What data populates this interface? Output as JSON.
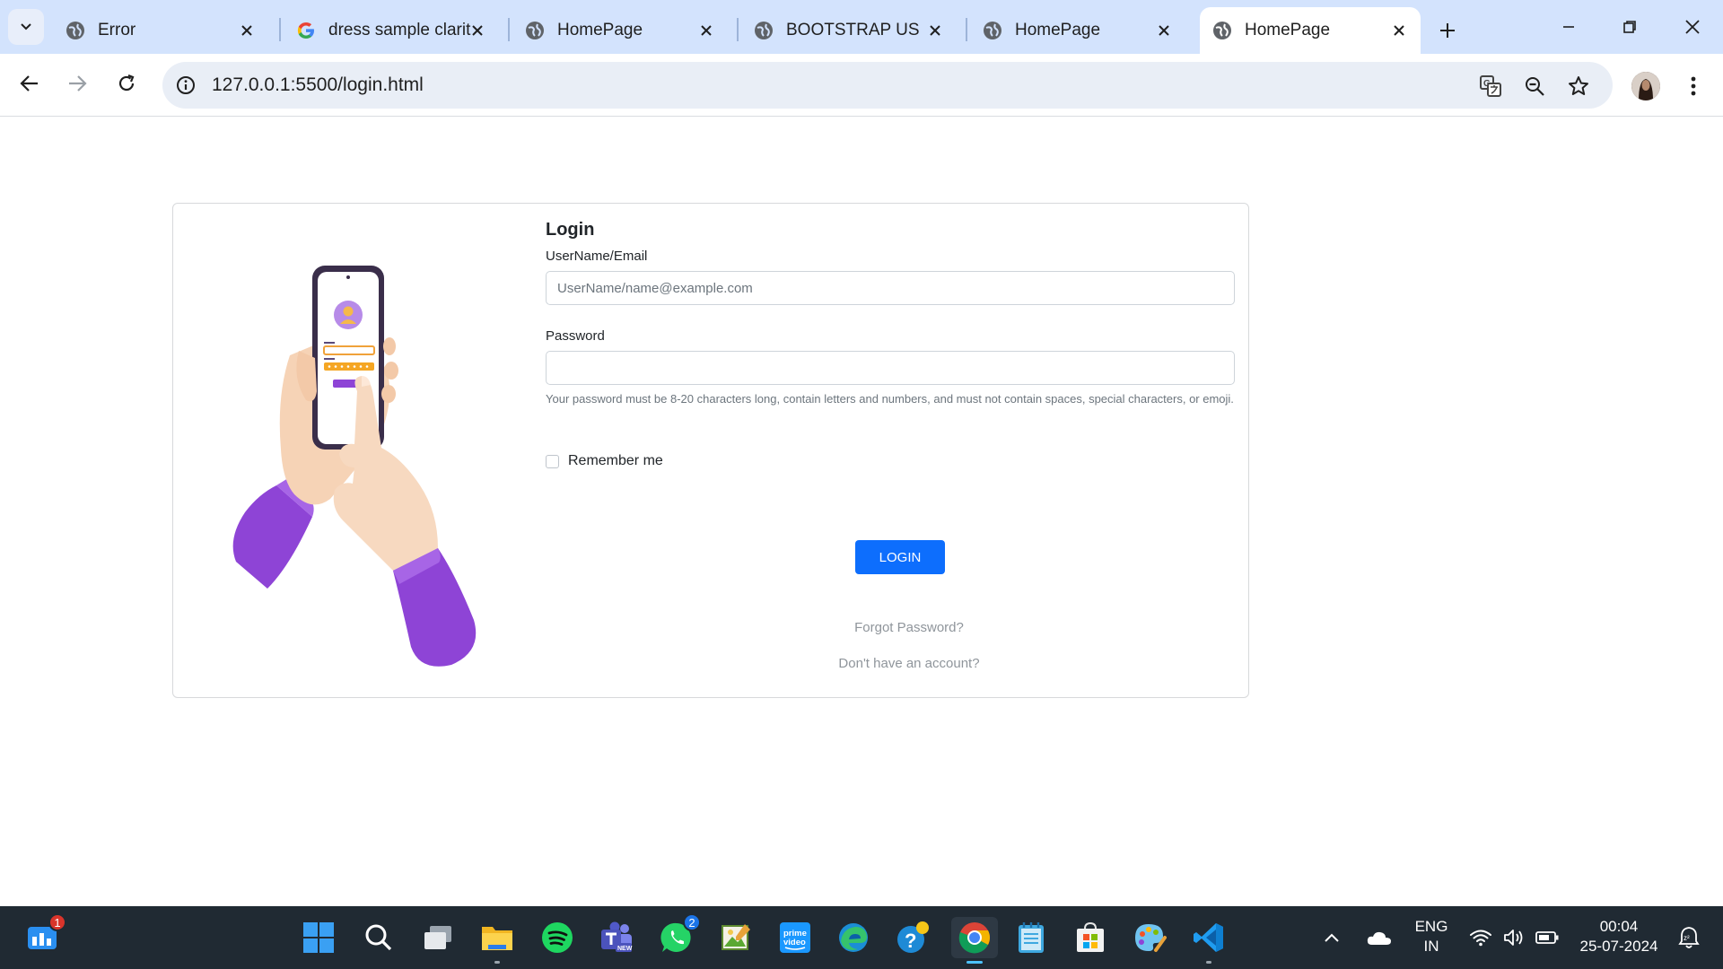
{
  "browser": {
    "tabs": [
      {
        "title": "Error",
        "icon": "globe-icon",
        "active": false
      },
      {
        "title": "dress sample clarit",
        "icon": "google-icon",
        "active": false
      },
      {
        "title": "HomePage",
        "icon": "globe-icon",
        "active": false
      },
      {
        "title": "BOOTSTRAP USING",
        "icon": "globe-icon",
        "active": false
      },
      {
        "title": "HomePage",
        "icon": "globe-icon",
        "active": false
      },
      {
        "title": "HomePage",
        "icon": "globe-icon",
        "active": true
      }
    ],
    "url": "127.0.0.1:5500/login.html"
  },
  "login": {
    "heading": "Login",
    "username_label": "UserName/Email",
    "username_placeholder": "UserName/name@example.com",
    "password_label": "Password",
    "password_help": "Your password must be 8-20 characters long, contain letters and numbers, and must not contain spaces, special characters, or emoji.",
    "remember_label": "Remember me",
    "login_button": "LOGIN",
    "forgot_link": "Forgot Password?",
    "signup_link": "Don't have an account?"
  },
  "taskbar": {
    "widgets_badge": "1",
    "whatsapp_badge": "2",
    "language": "ENG",
    "region": "IN",
    "time": "00:04",
    "date": "25-07-2024"
  },
  "colors": {
    "tabstrip": "#d3e3fd",
    "primary_button": "#0d6efd",
    "taskbar": "#202a33",
    "purple": "#8e44d6"
  }
}
